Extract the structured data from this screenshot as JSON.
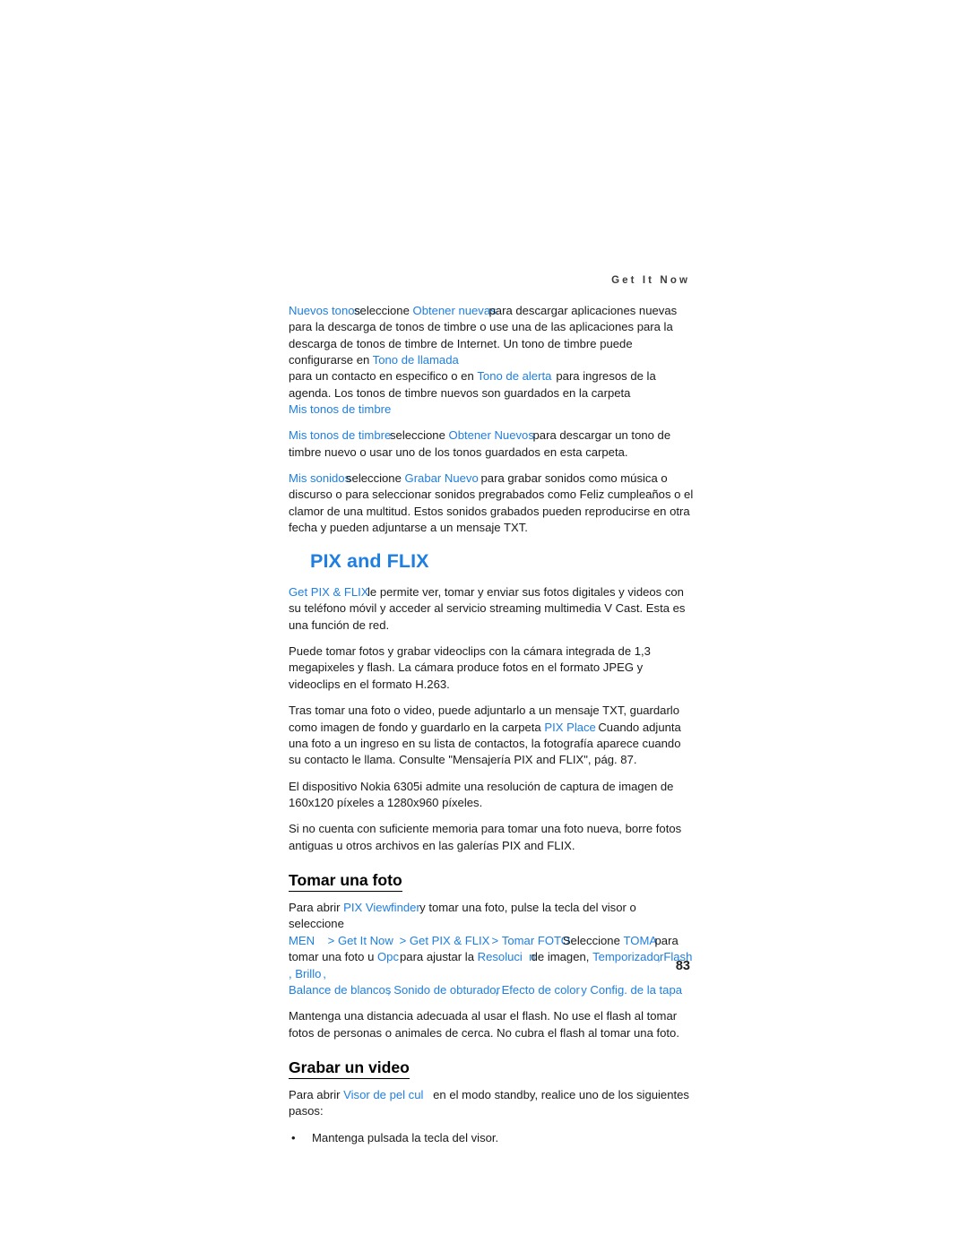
{
  "page": {
    "running_head": "Get It Now",
    "folio": "83",
    "accent_color": "#1f7fe0",
    "text_color": "#1a1a1a",
    "background": "#ffffff"
  },
  "content": {
    "p1": {
      "t1": "Nuevos tonos",
      "s1": "seleccione ",
      "t2": "Obtener nuevas",
      "s2": "para descargar aplicaciones nuevas para la descarga de tonos de timbre o use una de las aplicaciones para la descarga de tonos de timbre de Internet. Un tono de timbre puede configurarse en ",
      "t3": "Tono de llamada",
      "s3": "para un contacto en especifico o en ",
      "t4": "Tono de alerta",
      "s4": "para ingresos de la agenda. Los tonos de timbre nuevos son guardados en la carpeta ",
      "t5": "Mis tonos de timbre"
    },
    "p2": {
      "t1": "Mis tonos de timbre",
      "s1": "seleccione ",
      "t2": "Obtener Nuevos",
      "s2": "para descargar un tono de timbre nuevo o usar uno de los tonos guardados en esta carpeta."
    },
    "p3": {
      "t1": "Mis sonidos",
      "s1": "seleccione ",
      "t2": "Grabar Nuevo",
      "s2": "para grabar sonidos como música o discurso o para seleccionar sonidos pregrabados como Feliz cumpleaños o el clamor de una multitud. Estos sonidos grabados pueden reproducirse en otra fecha y pueden adjuntarse a un mensaje TXT."
    },
    "heading_pix_flix": "PIX and FLIX",
    "p4": {
      "t1": "Get PIX & FLIX",
      "s1": "le permite ver, tomar y enviar sus fotos digitales y videos con su teléfono móvil y acceder al servicio streaming multimedia V Cast. Esta es una función de red."
    },
    "p5": "Puede tomar fotos y grabar videoclips con la cámara integrada de 1,3 megapixeles y flash. La cámara produce fotos en el formato JPEG y videoclips en el formato H.263.",
    "p6": {
      "s1": "Tras tomar una foto o video, puede adjuntarlo a un mensaje TXT, guardarlo como imagen de fondo y guardarlo en la carpeta ",
      "t1": "PIX Place",
      "s2": "Cuando adjunta una foto a un ingreso en su lista de contactos, la fotografía aparece cuando su contacto le llama. Consulte \"Mensajería PIX and FLIX\", pág. 87."
    },
    "p7": "El dispositivo Nokia 6305i admite una resolución de captura de imagen de 160x120 píxeles a 1280x960 píxeles.",
    "p8": "Si no cuenta con suficiente memoria para tomar una foto nueva, borre fotos antiguas u otros archivos en las galerías PIX and FLIX.",
    "heading_tomar_foto": "Tomar una foto",
    "p9": {
      "s1": "Para abrir ",
      "t1": "PIX Viewfinder",
      "s2": "y tomar una foto, pulse la tecla del visor o seleccione",
      "t2": "MEN",
      "s3": " > ",
      "t3": "Get It Now",
      "s4": " > ",
      "t4": "Get PIX & FLIX",
      "s5": " > ",
      "t5": "Tomar FOTO",
      "s6": "Seleccione ",
      "t6": "TOMA",
      "s7": "para tomar una foto u ",
      "t7": "Opc",
      "s8": "para ajustar la ",
      "t8": "Resoluci  n",
      "s9": "de imagen, ",
      "t9": "Temporizador",
      "s10": ", ",
      "t10": "Flash",
      "s11": ", ",
      "t11": "Brillo",
      "s12": ", ",
      "t12": "Balance de blancos",
      "s13": ", ",
      "t13": "Sonido de obturador",
      "s14": ", ",
      "t14": "Efecto de color",
      "s15": " y ",
      "t15": "Config. de la tapa"
    },
    "p10": "Mantenga una distancia adecuada al usar el flash. No use el flash al tomar fotos de personas o animales de cerca. No cubra el flash al tomar una foto.",
    "heading_grabar_video": "Grabar un video",
    "p11": {
      "s1": "Para abrir ",
      "t1": "Visor de pel cul",
      "s2": "en el modo standby, realice uno de los siguientes pasos:"
    },
    "bullets": [
      {
        "marker": "•",
        "text": "Mantenga pulsada la tecla del visor."
      }
    ]
  }
}
